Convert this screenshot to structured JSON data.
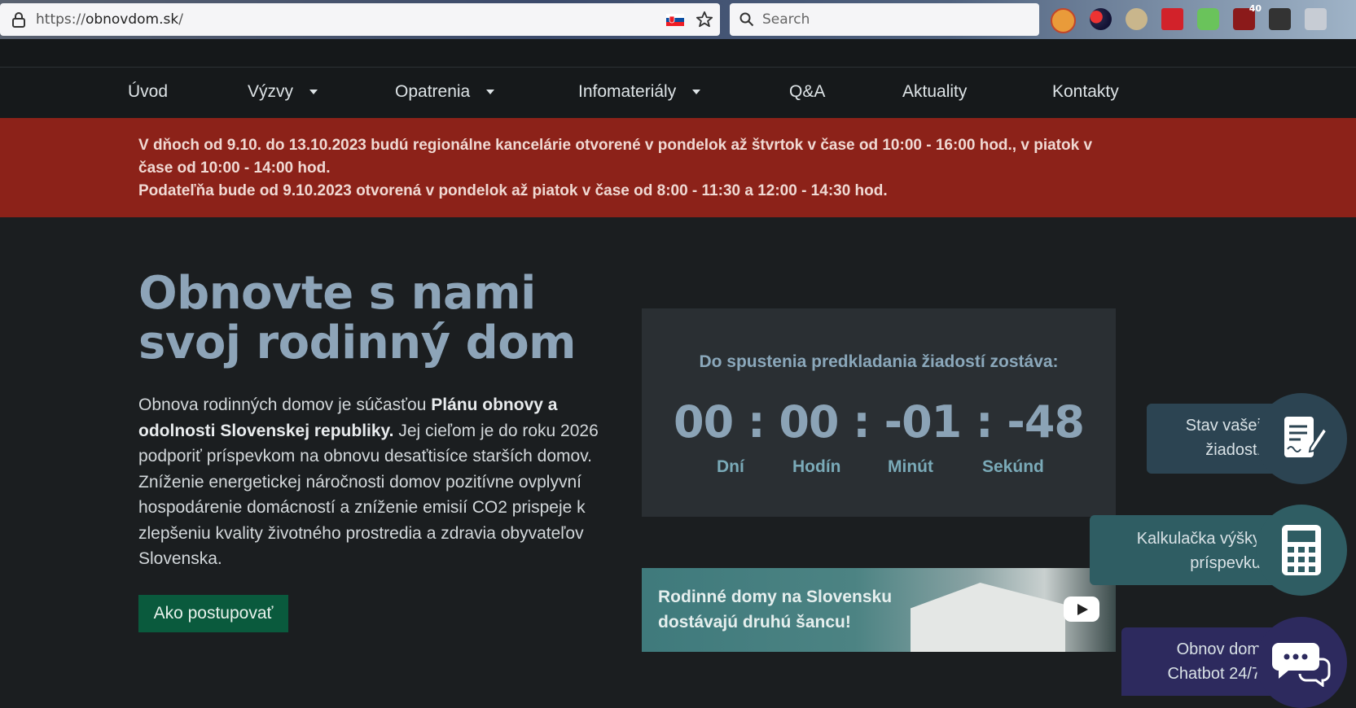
{
  "browser": {
    "url_prefix": "https://",
    "url_host": "obnovdom.sk",
    "url_suffix": "/",
    "search_placeholder": "Search",
    "badge_count": "40"
  },
  "nav": {
    "items": [
      {
        "label": "Úvod",
        "dropdown": false
      },
      {
        "label": "Výzvy",
        "dropdown": true
      },
      {
        "label": "Opatrenia",
        "dropdown": true
      },
      {
        "label": "Infomateriály",
        "dropdown": true
      },
      {
        "label": "Q&A",
        "dropdown": false
      },
      {
        "label": "Aktuality",
        "dropdown": false
      },
      {
        "label": "Kontakty",
        "dropdown": false
      }
    ]
  },
  "alert": {
    "line1": "V dňoch od 9.10. do 13.10.2023 budú regionálne kancelárie otvorené v pondelok až štvrtok v čase od 10:00 - 16:00 hod., v piatok v čase od 10:00 - 14:00 hod.",
    "line2": "Podateľňa bude od 9.10.2023 otvorená v pondelok až piatok v čase od 8:00 - 11:30 a 12:00 - 14:30 hod."
  },
  "hero": {
    "title": "Obnovte s nami svoj rodinný dom",
    "body_part1": "Obnova rodinných domov je súčasťou ",
    "body_bold": "Plánu obnovy a odolnosti Slovenskej republiky.",
    "body_part2": " Jej cieľom je do roku 2026 podporiť príspevkom na obnovu desaťtisíce starších domov. Zníženie energetickej náročnosti domov pozitívne ovplyvní hospodárenie domácností a zníženie emisií CO2 prispeje k zlepšeniu kvality životného prostredia a zdravia obyvateľov Slovenska.",
    "cta_label": "Ako postupovať"
  },
  "countdown": {
    "heading": "Do spustenia predkladania žiadostí zostáva:",
    "values": "00 : 00 : -01 : -48",
    "labels": [
      "Dní",
      "Hodín",
      "Minút",
      "Sekúnd"
    ]
  },
  "video": {
    "title": "Rodinné domy na Slovensku dostávajú druhú šancu!"
  },
  "widgets": {
    "status": {
      "line1": "Stav vašej",
      "line2": "žiadosti",
      "color": "#2c4452"
    },
    "calculator": {
      "line1": "Kalkulačka výšky",
      "line2": "príspevku",
      "color": "#2f5d63"
    },
    "chatbot": {
      "line1": "Obnov dom",
      "line2": "Chatbot 24/7",
      "color": "#2d2a5e"
    }
  },
  "colors": {
    "alert_bg": "#8c2219",
    "cta_bg": "#0a5a3d",
    "title_color": "#8da4b8"
  }
}
